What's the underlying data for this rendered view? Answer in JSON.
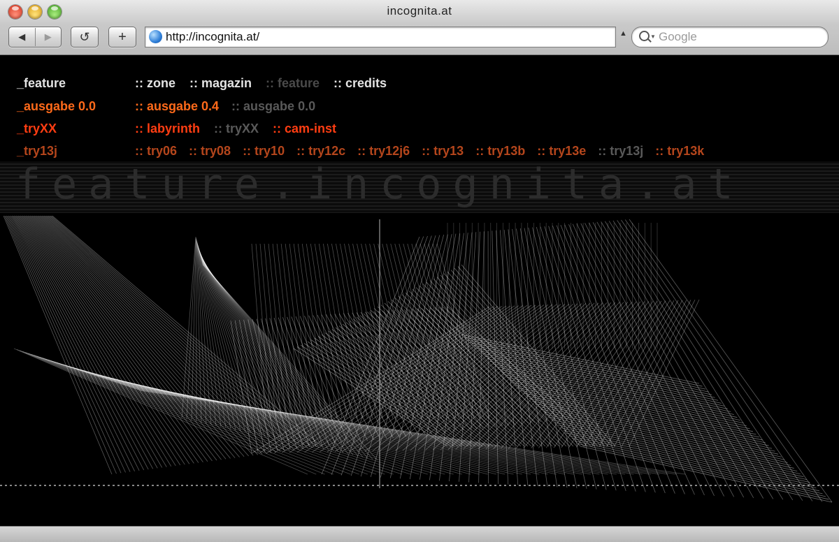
{
  "window": {
    "title": "incognita.at"
  },
  "toolbar": {
    "back_icon": "◀",
    "forward_icon": "▶",
    "reload_icon": "↺",
    "add_bookmark_icon": "+",
    "url": "http://incognita.at/",
    "search_placeholder": "Google"
  },
  "nav": {
    "rows": [
      {
        "head": "_feature",
        "links": [
          ":: zone",
          ":: magazin",
          ":: feature",
          ":: credits"
        ]
      },
      {
        "head": "_ausgabe 0.0",
        "links": [
          ":: ausgabe 0.4",
          ":: ausgabe 0.0"
        ]
      },
      {
        "head": "_tryXX",
        "links": [
          ":: labyrinth",
          ":: tryXX",
          ":: cam-inst"
        ]
      },
      {
        "head": "_try13j",
        "links": [
          ":: try06",
          ":: try08",
          ":: try10",
          ":: try12c",
          ":: try12j6",
          ":: try13",
          ":: try13b",
          ":: try13e",
          ":: try13j",
          ":: try13k"
        ]
      }
    ]
  },
  "banner": {
    "text": "feature.incognita.at"
  },
  "colors": {
    "white": "#e4e4e4",
    "orange": "#ff6a1a",
    "red": "#ff3d12",
    "dim_orange": "#b5461c",
    "current": "#4a4a4a"
  }
}
